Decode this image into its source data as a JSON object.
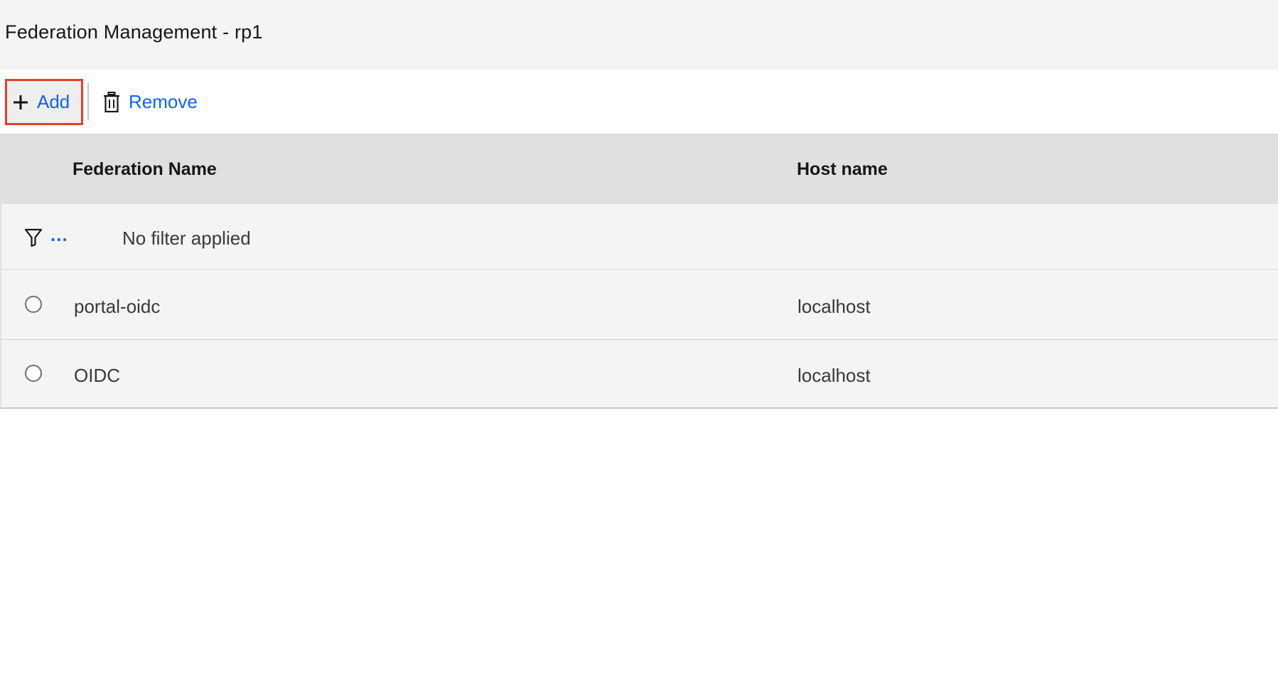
{
  "header": {
    "title": "Federation Management - rp1"
  },
  "toolbar": {
    "add_label": "Add",
    "remove_label": "Remove",
    "add_icon": "plus-icon",
    "remove_icon": "trash-icon"
  },
  "table": {
    "columns": [
      "Federation Name",
      "Host name"
    ],
    "filter": {
      "more_label": "...",
      "status_text": "No filter applied"
    },
    "rows": [
      {
        "name": "portal-oidc",
        "host": "localhost"
      },
      {
        "name": "OIDC",
        "host": "localhost"
      }
    ]
  },
  "colors": {
    "link": "#0f62fe",
    "highlight_border": "#e0402b",
    "header_bg": "#e0e0e0",
    "row_bg": "#f4f4f4"
  }
}
